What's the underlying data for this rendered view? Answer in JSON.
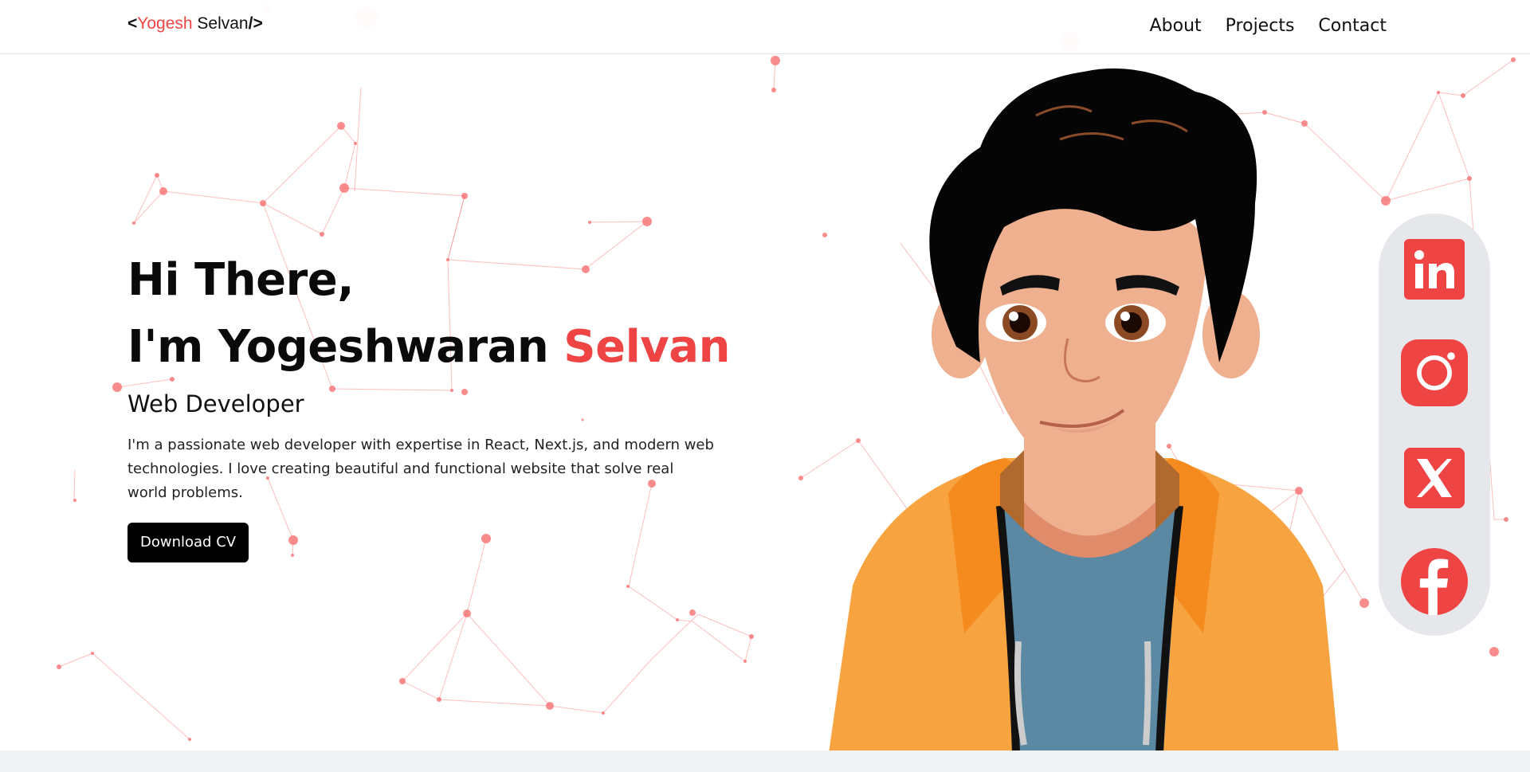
{
  "logo": {
    "open": "<",
    "first": "Yogesh",
    "last": " Selvan",
    "close": "/>"
  },
  "nav": {
    "about": "About",
    "projects": "Projects",
    "contact": "Contact"
  },
  "hero": {
    "greeting": "Hi There,",
    "intro": "I'm Yogeshwaran ",
    "surname": "Selvan",
    "role": "Web Developer",
    "description": "I'm a passionate web developer with expertise in React, Next.js, and modern web technologies. I love creating beautiful and functional website that solve real world problems.",
    "cta": "Download CV"
  },
  "social": [
    {
      "name": "linkedin",
      "icon": "linkedin-icon"
    },
    {
      "name": "instagram",
      "icon": "instagram-icon"
    },
    {
      "name": "x",
      "icon": "x-icon"
    },
    {
      "name": "facebook",
      "icon": "facebook-icon"
    }
  ],
  "colors": {
    "accent": "#ef4444",
    "dark": "#000000",
    "panel": "#e5e7eb",
    "footer": "#f1f2f4"
  }
}
